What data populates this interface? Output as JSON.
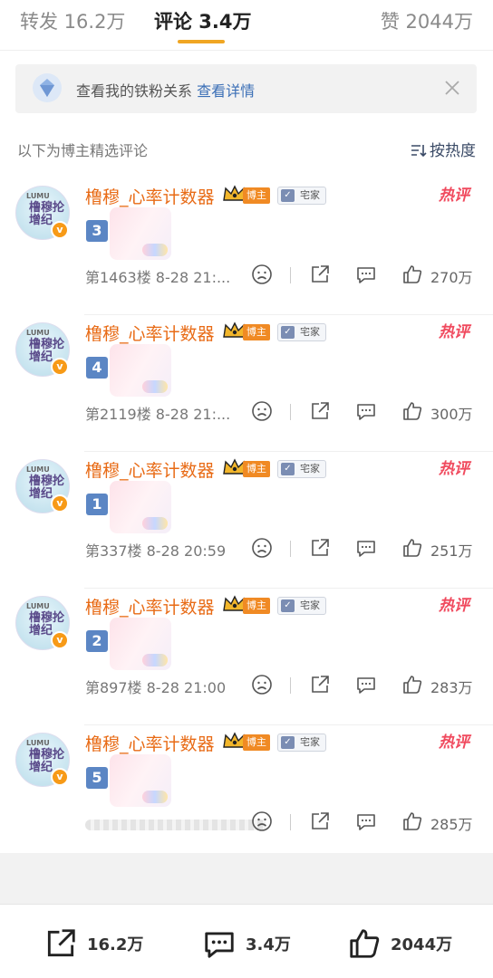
{
  "tabs": {
    "repost": "转发 16.2万",
    "comment": "评论 3.4万",
    "like": "赞 2044万"
  },
  "banner": {
    "text": "查看我的铁粉关系",
    "link": "查看详情"
  },
  "section": {
    "header": "以下为博主精选评论",
    "sort_label": "按热度"
  },
  "comments": [
    {
      "avatar_top": "LUMU",
      "avatar_main": "橹穆抡增纪",
      "username": "橹穆_心率计数器",
      "badge": "博主",
      "tag": "宅家",
      "hot": "热评",
      "number": "3",
      "meta": "第1463楼 8-28 21:...",
      "likes": "270万"
    },
    {
      "avatar_top": "LUMU",
      "avatar_main": "橹穆抡增纪",
      "username": "橹穆_心率计数器",
      "badge": "博主",
      "tag": "宅家",
      "hot": "热评",
      "number": "4",
      "meta": "第2119楼 8-28 21:...",
      "likes": "300万"
    },
    {
      "avatar_top": "LUMU",
      "avatar_main": "橹穆抡增纪",
      "username": "橹穆_心率计数器",
      "badge": "博主",
      "tag": "宅家",
      "hot": "热评",
      "number": "1",
      "meta": "第337楼 8-28 20:59",
      "likes": "251万"
    },
    {
      "avatar_top": "LUMU",
      "avatar_main": "橹穆抡增纪",
      "username": "橹穆_心率计数器",
      "badge": "博主",
      "tag": "宅家",
      "hot": "热评",
      "number": "2",
      "meta": "第897楼 8-28 21:00",
      "likes": "283万"
    },
    {
      "avatar_top": "LUMU",
      "avatar_main": "橹穆抡增纪",
      "username": "橹穆_心率计数器",
      "badge": "博主",
      "tag": "宅家",
      "hot": "热评",
      "number": "5",
      "meta": "",
      "likes": "285万"
    }
  ],
  "bottom_bar": {
    "share_count": "16.2万",
    "comment_count": "3.4万",
    "like_count": "2044万"
  },
  "colors": {
    "accent": "#f0a623",
    "username": "#e86b16",
    "hot": "#f04a5e",
    "link": "#3b6fb6"
  }
}
